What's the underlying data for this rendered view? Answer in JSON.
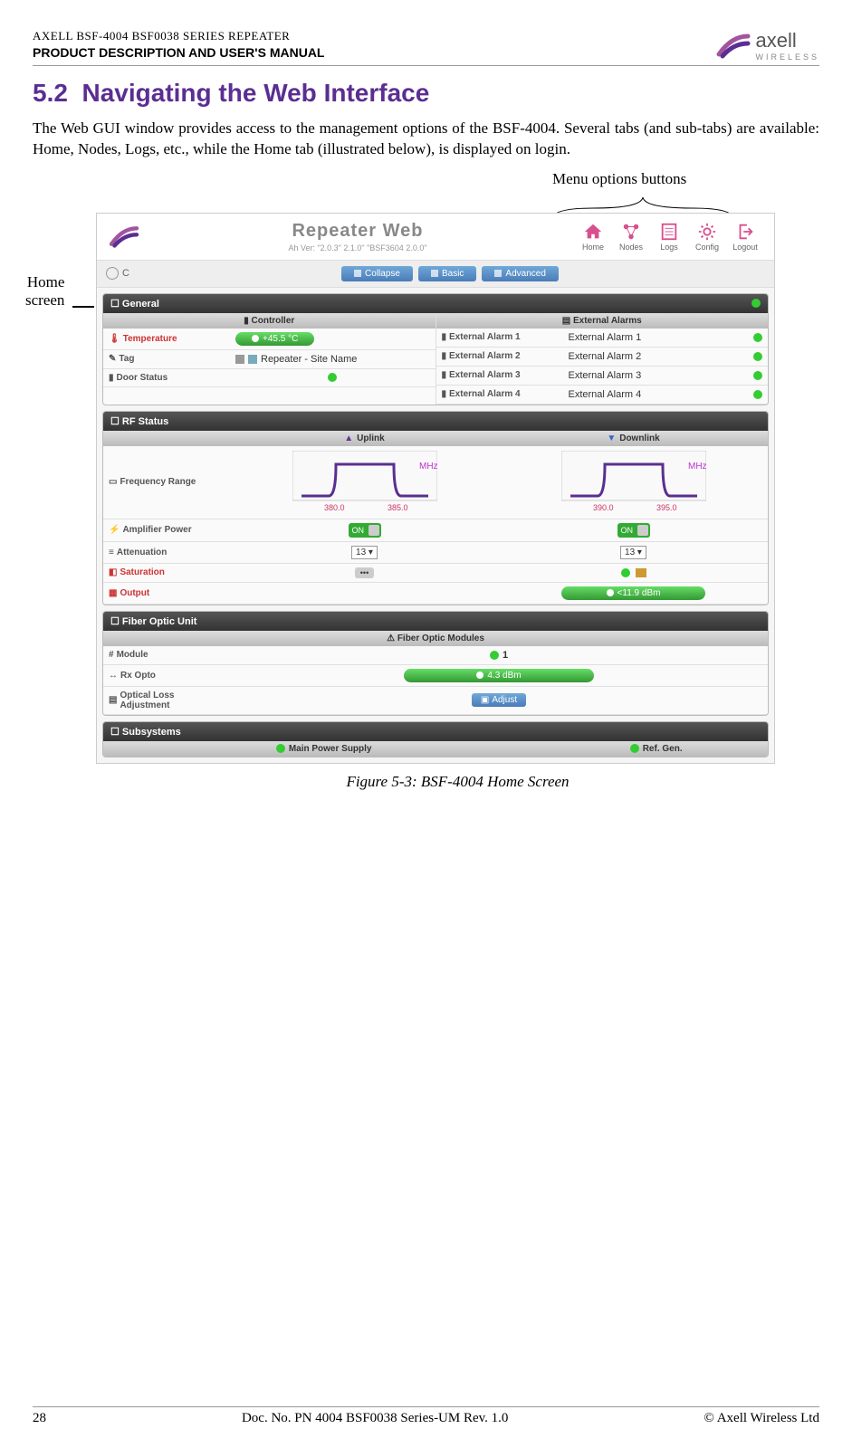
{
  "header": {
    "line1": "AXELL BSF-4004 BSF0038 SERIES REPEATER",
    "line2": "PRODUCT DESCRIPTION AND USER'S MANUAL",
    "brand": "axell",
    "brand_sub": "WIRELESS"
  },
  "section": {
    "number": "5.2",
    "title": "Navigating the Web Interface"
  },
  "para": "The Web GUI window provides access to the management options of the BSF-4004. Several tabs (and sub-tabs) are available: Home, Nodes, Logs, etc., while the Home tab (illustrated below), is displayed on login.",
  "callouts": {
    "menu": "Menu options buttons",
    "home_ln1": "Home",
    "home_ln2": "screen"
  },
  "webui": {
    "title": "Repeater Web",
    "version": "Ah Ver: \"2.0.3\" 2.1.0\" \"BSF3604 2.0.0\"",
    "menu": [
      {
        "label": "Home",
        "color": "#d94f8f"
      },
      {
        "label": "Nodes",
        "color": "#d94f8f"
      },
      {
        "label": "Logs",
        "color": "#d94f8f"
      },
      {
        "label": "Config",
        "color": "#d94f8f"
      },
      {
        "label": "Logout",
        "color": "#d94f8f"
      }
    ],
    "btn_collapse": "Collapse",
    "btn_basic": "Basic",
    "btn_advanced": "Advanced",
    "general": {
      "title": "General",
      "controller_hdr": "Controller",
      "ext_hdr": "External Alarms",
      "temperature_label": "Temperature",
      "temperature_val": "+45.5 °C",
      "tag_label": "Tag",
      "tag_val": "Repeater - Site Name",
      "door_label": "Door Status",
      "ext_alarms": [
        {
          "label": "External Alarm 1",
          "val": "External Alarm 1"
        },
        {
          "label": "External Alarm 2",
          "val": "External Alarm 2"
        },
        {
          "label": "External Alarm 3",
          "val": "External Alarm 3"
        },
        {
          "label": "External Alarm 4",
          "val": "External Alarm 4"
        }
      ]
    },
    "rf": {
      "title": "RF Status",
      "uplink": "Uplink",
      "downlink": "Downlink",
      "freq_label": "Frequency Range",
      "mhz": "MHz",
      "up_low": "380.0",
      "up_high": "385.0",
      "dl_low": "390.0",
      "dl_high": "395.0",
      "amp_label": "Amplifier Power",
      "att_label": "Attenuation",
      "att_val": "13",
      "sat_label": "Saturation",
      "out_label": "Output",
      "out_val": "<11.9 dBm",
      "on": "ON"
    },
    "fiber": {
      "title": "Fiber Optic Unit",
      "sub": "Fiber Optic Modules",
      "module_label": "Module",
      "module_val": "1",
      "rx_label": "Rx Opto",
      "rx_val": "4.3 dBm",
      "adj_label": "Optical Loss Adjustment",
      "adj_btn": "Adjust"
    },
    "sub": {
      "title": "Subsystems",
      "power": "Main Power Supply",
      "ref": "Ref. Gen."
    }
  },
  "figure_caption": "Figure 5-3:  BSF-4004 Home Screen",
  "footer": {
    "page": "28",
    "doc": "Doc. No. PN 4004 BSF0038 Series-UM Rev. 1.0",
    "copy": "© Axell Wireless Ltd"
  },
  "chart_data": [
    {
      "type": "line",
      "title": "Uplink Frequency Range",
      "xlabel": "MHz",
      "x": [
        378,
        380,
        380.2,
        384.8,
        385,
        387
      ],
      "values": [
        0,
        0,
        1,
        1,
        0,
        0
      ],
      "ylim": [
        0,
        1
      ],
      "annotations": [
        "380.0",
        "385.0"
      ]
    },
    {
      "type": "line",
      "title": "Downlink Frequency Range",
      "xlabel": "MHz",
      "x": [
        388,
        390,
        390.2,
        394.8,
        395,
        397
      ],
      "values": [
        0,
        0,
        1,
        1,
        0,
        0
      ],
      "ylim": [
        0,
        1
      ],
      "annotations": [
        "390.0",
        "395.0"
      ]
    }
  ]
}
